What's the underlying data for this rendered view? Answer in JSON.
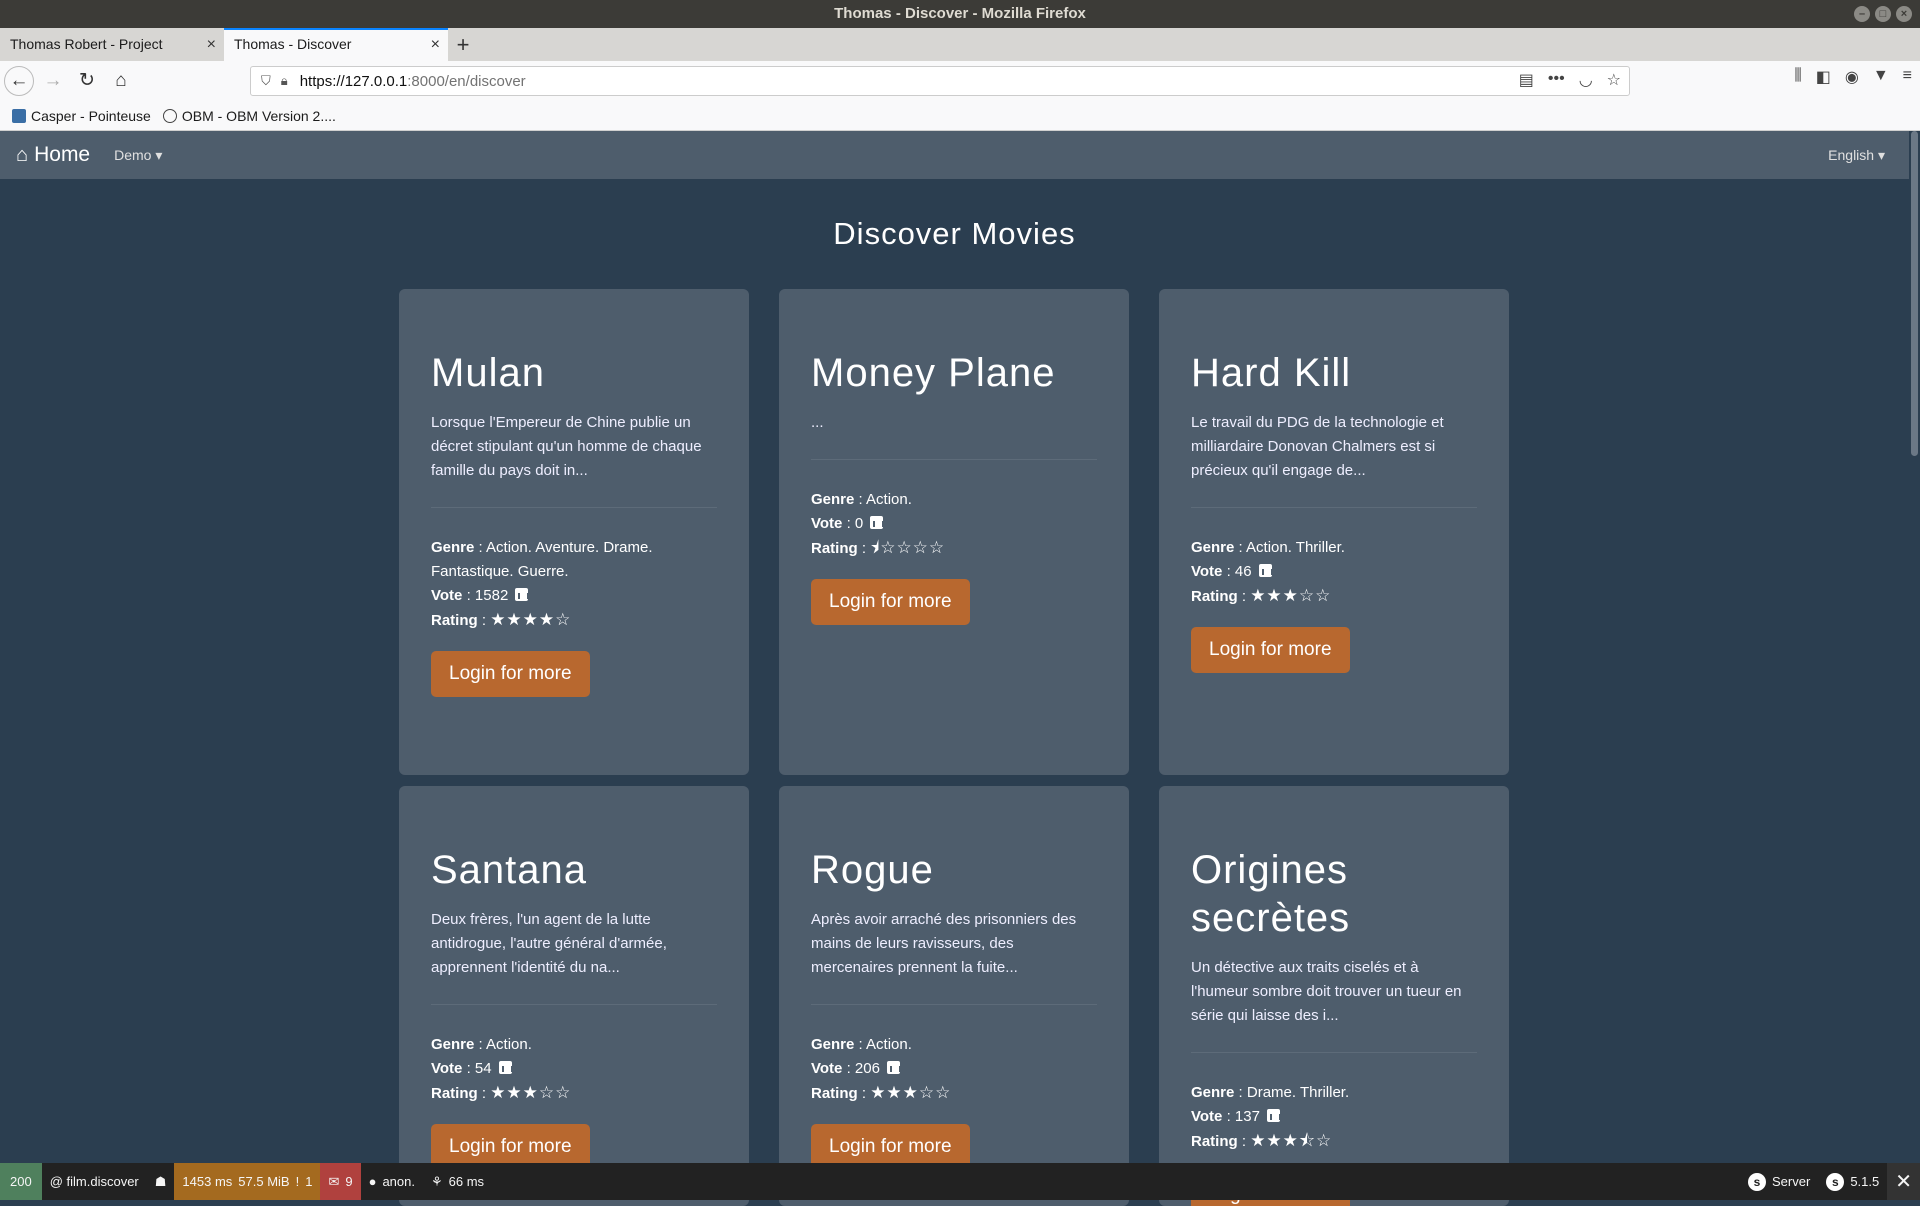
{
  "window": {
    "title": "Thomas - Discover - Mozilla Firefox"
  },
  "tabs": [
    {
      "title": "Thomas Robert - Project",
      "active": false
    },
    {
      "title": "Thomas - Discover",
      "active": true
    }
  ],
  "address_bar": {
    "url_host": "https://127.0.0.1",
    "url_path": ":8000/en/discover"
  },
  "bookmarks": [
    {
      "label": "Casper - Pointeuse",
      "icon": "calendar-icon"
    },
    {
      "label": "OBM - OBM Version 2....",
      "icon": "globe-icon"
    }
  ],
  "site_nav": {
    "brand": "Home",
    "demo_menu": "Demo",
    "language": "English"
  },
  "page": {
    "title": "Discover Movies"
  },
  "labels": {
    "genre": "Genre",
    "vote": "Vote",
    "rating": "Rating",
    "login_button": "Login for more"
  },
  "movies": [
    {
      "title": "Mulan",
      "description": "Lorsque l'Empereur de Chine publie un décret stipulant qu'un homme de chaque famille du pays doit in...",
      "genre": "Action. Aventure. Drame. Fantastique. Guerre.",
      "vote": "1582",
      "rating_stars": "★★★★☆"
    },
    {
      "title": "Money Plane",
      "description": "...",
      "genre": "Action.",
      "vote": "0",
      "rating_stars": "⯨☆☆☆☆"
    },
    {
      "title": "Hard Kill",
      "description": "Le travail du PDG de la technologie et milliardaire Donovan Chalmers est si précieux qu'il engage de...",
      "genre": "Action. Thriller.",
      "vote": "46",
      "rating_stars": "★★★☆☆"
    },
    {
      "title": "Santana",
      "description": "Deux frères, l'un agent de la lutte antidrogue, l'autre général d'armée, apprennent l'identité du na...",
      "genre": "Action.",
      "vote": "54",
      "rating_stars": "★★★☆☆"
    },
    {
      "title": "Rogue",
      "description": "Après avoir arraché des prisonniers des mains de leurs ravisseurs, des mercenaires prennent la fuite...",
      "genre": "Action.",
      "vote": "206",
      "rating_stars": "★★★☆☆"
    },
    {
      "title": "Origines secrètes",
      "description": "Un détective aux traits ciselés et à l'humeur sombre doit trouver un tueur en série qui laisse des i...",
      "genre": "Drame. Thriller.",
      "vote": "137",
      "rating_stars": "★★★⯪☆"
    }
  ],
  "debug_bar": {
    "status": "200",
    "route": "@ film.discover",
    "time": "1453 ms",
    "memory": "57.5 MiB",
    "warnings": "1",
    "errors": "9",
    "user": "anon.",
    "twig_time": "66 ms",
    "server_label": "Server",
    "symfony_version": "5.1.5"
  },
  "colors": {
    "background": "#2b3e50",
    "card": "#4e5d6c",
    "button": "#b8682f"
  }
}
